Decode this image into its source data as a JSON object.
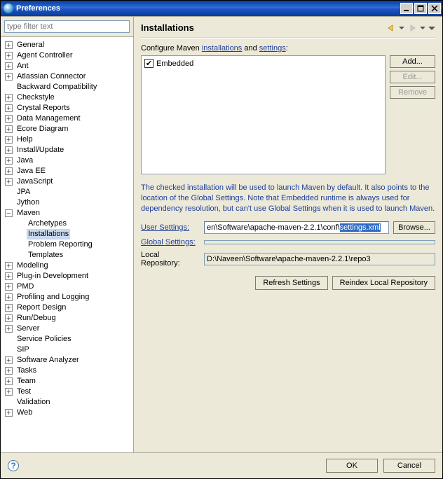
{
  "window": {
    "title": "Preferences"
  },
  "filter": {
    "placeholder": "type filter text"
  },
  "tree": [
    {
      "label": "General",
      "expandable": true,
      "expanded": false,
      "depth": 0
    },
    {
      "label": "Agent Controller",
      "expandable": true,
      "expanded": false,
      "depth": 0
    },
    {
      "label": "Ant",
      "expandable": true,
      "expanded": false,
      "depth": 0
    },
    {
      "label": "Atlassian Connector",
      "expandable": true,
      "expanded": false,
      "depth": 0
    },
    {
      "label": "Backward Compatibility",
      "expandable": false,
      "depth": 0
    },
    {
      "label": "Checkstyle",
      "expandable": true,
      "expanded": false,
      "depth": 0
    },
    {
      "label": "Crystal Reports",
      "expandable": true,
      "expanded": false,
      "depth": 0
    },
    {
      "label": "Data Management",
      "expandable": true,
      "expanded": false,
      "depth": 0
    },
    {
      "label": "Ecore Diagram",
      "expandable": true,
      "expanded": false,
      "depth": 0
    },
    {
      "label": "Help",
      "expandable": true,
      "expanded": false,
      "depth": 0
    },
    {
      "label": "Install/Update",
      "expandable": true,
      "expanded": false,
      "depth": 0
    },
    {
      "label": "Java",
      "expandable": true,
      "expanded": false,
      "depth": 0
    },
    {
      "label": "Java EE",
      "expandable": true,
      "expanded": false,
      "depth": 0
    },
    {
      "label": "JavaScript",
      "expandable": true,
      "expanded": false,
      "depth": 0
    },
    {
      "label": "JPA",
      "expandable": false,
      "depth": 0
    },
    {
      "label": "Jython",
      "expandable": false,
      "depth": 0
    },
    {
      "label": "Maven",
      "expandable": true,
      "expanded": true,
      "depth": 0
    },
    {
      "label": "Archetypes",
      "expandable": false,
      "depth": 1
    },
    {
      "label": "Installations",
      "expandable": false,
      "depth": 1,
      "selected": true
    },
    {
      "label": "Problem Reporting",
      "expandable": false,
      "depth": 1
    },
    {
      "label": "Templates",
      "expandable": false,
      "depth": 1
    },
    {
      "label": "Modeling",
      "expandable": true,
      "expanded": false,
      "depth": 0
    },
    {
      "label": "Plug-in Development",
      "expandable": true,
      "expanded": false,
      "depth": 0
    },
    {
      "label": "PMD",
      "expandable": true,
      "expanded": false,
      "depth": 0
    },
    {
      "label": "Profiling and Logging",
      "expandable": true,
      "expanded": false,
      "depth": 0
    },
    {
      "label": "Report Design",
      "expandable": true,
      "expanded": false,
      "depth": 0
    },
    {
      "label": "Run/Debug",
      "expandable": true,
      "expanded": false,
      "depth": 0
    },
    {
      "label": "Server",
      "expandable": true,
      "expanded": false,
      "depth": 0
    },
    {
      "label": "Service Policies",
      "expandable": false,
      "depth": 0
    },
    {
      "label": "SIP",
      "expandable": false,
      "depth": 0
    },
    {
      "label": "Software Analyzer",
      "expandable": true,
      "expanded": false,
      "depth": 0
    },
    {
      "label": "Tasks",
      "expandable": true,
      "expanded": false,
      "depth": 0
    },
    {
      "label": "Team",
      "expandable": true,
      "expanded": false,
      "depth": 0
    },
    {
      "label": "Test",
      "expandable": true,
      "expanded": false,
      "depth": 0
    },
    {
      "label": "Validation",
      "expandable": false,
      "depth": 0
    },
    {
      "label": "Web",
      "expandable": true,
      "expanded": false,
      "depth": 0
    }
  ],
  "page": {
    "title": "Installations",
    "config_prefix": "Configure Maven ",
    "link_installations": "installations",
    "config_and": " and ",
    "link_settings": "settings",
    "config_suffix": ":",
    "list_item": "Embedded",
    "add_btn": "Add...",
    "edit_btn": "Edit...",
    "remove_btn": "Remove",
    "description": "The checked installation will be used to launch Maven by default. It also points to the location of the Global Settings. Note that Embedded runtime is always used for dependency resolution, but can't use Global Settings when it is used to launch Maven.",
    "user_settings_label": "User Settings:",
    "user_settings_value_prefix": "en\\Software\\apache-maven-2.2.1\\conf\\",
    "user_settings_value_selected": "settings.xml",
    "browse_btn": "Browse...",
    "global_settings_label": "Global Settings:",
    "global_settings_value": "",
    "local_repo_label": "Local Repository:",
    "local_repo_value": "D:\\Naveen\\Software\\apache-maven-2.2.1\\repo3",
    "refresh_btn": "Refresh Settings",
    "reindex_btn": "Reindex Local Repository"
  },
  "footer": {
    "ok": "OK",
    "cancel": "Cancel"
  }
}
